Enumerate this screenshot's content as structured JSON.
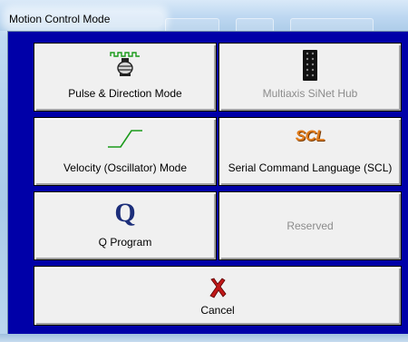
{
  "window": {
    "title": "Motion Control Mode"
  },
  "buttons": {
    "pulse": {
      "label": "Pulse & Direction Mode",
      "icon": "pulse-direction-icon"
    },
    "multiaxis": {
      "label": "Multiaxis SiNet Hub",
      "icon": "hub-chip-icon"
    },
    "velocity": {
      "label": "Velocity (Oscillator) Mode",
      "icon": "velocity-ramp-icon"
    },
    "scl": {
      "label": "Serial Command Language (SCL)",
      "icon_text": "SCL",
      "icon": "scl-logo-icon"
    },
    "qprogram": {
      "label": "Q Program",
      "icon_text": "Q",
      "icon": "q-program-icon"
    },
    "reserved": {
      "label": "Reserved"
    },
    "cancel": {
      "label": "Cancel",
      "icon": "red-x-icon"
    }
  },
  "colors": {
    "client_bg": "#0000a8",
    "button_face": "#f0f0f0",
    "scl_orange": "#e07b1a",
    "q_blue": "#1c2e7a",
    "cancel_red": "#c01818",
    "pulse_green": "#1a9a1a"
  }
}
